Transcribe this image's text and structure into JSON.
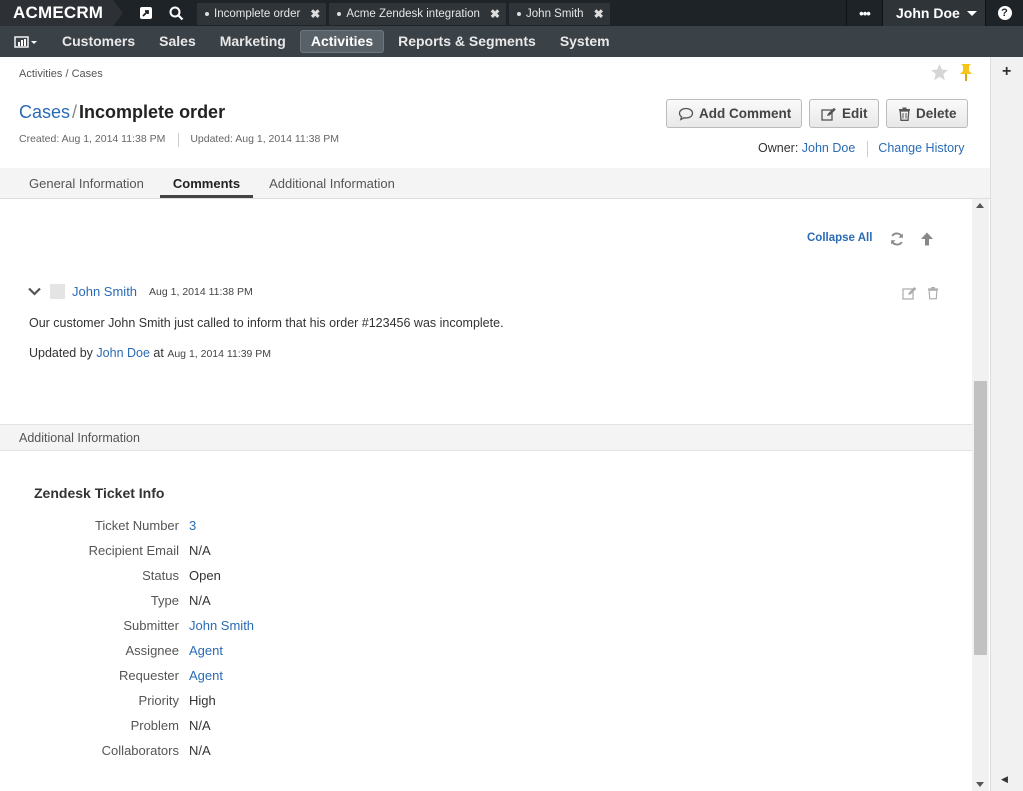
{
  "topbar": {
    "brand": "ACMECRM",
    "tabs": [
      {
        "label": "Incomplete order"
      },
      {
        "label": "Acme Zendesk integration"
      },
      {
        "label": "John Smith"
      }
    ],
    "more": "•••",
    "user": "John Doe",
    "help": "?"
  },
  "nav": {
    "items": [
      {
        "label": "Customers"
      },
      {
        "label": "Sales"
      },
      {
        "label": "Marketing"
      },
      {
        "label": "Activities",
        "active": true
      },
      {
        "label": "Reports & Segments"
      },
      {
        "label": "System"
      }
    ]
  },
  "page": {
    "breadcrumb": "Activities / Cases",
    "title_parent": "Cases",
    "title_sep": "/",
    "title_name": "Incomplete order",
    "created": "Created: Aug 1, 2014 11:38 PM",
    "updated": "Updated: Aug 1, 2014 11:38 PM",
    "buttons": {
      "add_comment": "Add Comment",
      "edit": "Edit",
      "delete": "Delete"
    },
    "owner_label": "Owner:",
    "owner_name": "John Doe",
    "change_history": "Change History"
  },
  "tabs": [
    {
      "label": "General Information"
    },
    {
      "label": "Comments",
      "active": true
    },
    {
      "label": "Additional Information"
    }
  ],
  "comments": {
    "collapse_all": "Collapse All",
    "items": [
      {
        "author": "John Smith",
        "date": "Aug 1, 2014 11:38 PM",
        "body": "Our customer John Smith just called to inform that his order #123456 was incomplete.",
        "updated_prefix": "Updated by",
        "updated_by": "John Doe",
        "updated_at_word": "at",
        "updated_date": "Aug 1, 2014 11:39 PM"
      }
    ]
  },
  "additional": {
    "section_title": "Additional Information",
    "zendesk_title": "Zendesk Ticket Info",
    "fields": [
      {
        "label": "Ticket Number",
        "value": "3",
        "link": true
      },
      {
        "label": "Recipient Email",
        "value": "N/A",
        "link": false
      },
      {
        "label": "Status",
        "value": "Open",
        "link": false
      },
      {
        "label": "Type",
        "value": "N/A",
        "link": false
      },
      {
        "label": "Submitter",
        "value": "John Smith",
        "link": true
      },
      {
        "label": "Assignee",
        "value": "Agent",
        "link": true
      },
      {
        "label": "Requester",
        "value": "Agent",
        "link": true
      },
      {
        "label": "Priority",
        "value": "High",
        "link": false
      },
      {
        "label": "Problem",
        "value": "N/A",
        "link": false
      },
      {
        "label": "Collaborators",
        "value": "N/A",
        "link": false
      }
    ]
  },
  "gutter": {
    "plus": "+"
  },
  "colors": {
    "accent": "#2a6bb5",
    "topbar": "#1e2328",
    "navbar": "#3a4147",
    "pin": "#f5c518"
  }
}
